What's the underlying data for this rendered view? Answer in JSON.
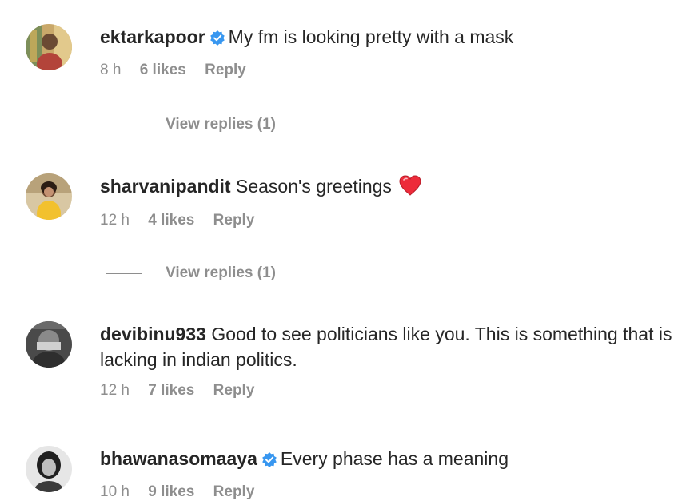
{
  "colors": {
    "text": "#262626",
    "muted": "#8e8e8e",
    "verified": "#3897f0",
    "heart": "#ed2b3a"
  },
  "comments": [
    {
      "username": "ektarkapoor",
      "verified": true,
      "text": "My fm is looking pretty with a mask",
      "time": "8 h",
      "likes": "6 likes",
      "reply": "Reply",
      "view_replies": "View replies (1)",
      "avatar": "avatar"
    },
    {
      "username": "sharvanipandit",
      "verified": false,
      "text": "Season's greetings",
      "emoji": "heart-icon",
      "time": "12 h",
      "likes": "4 likes",
      "reply": "Reply",
      "view_replies": "View replies (1)",
      "avatar": "avatar"
    },
    {
      "username": "devibinu933",
      "verified": false,
      "text": "Good to see politicians like you. This is something that is lacking in indian politics.",
      "time": "12 h",
      "likes": "7 likes",
      "reply": "Reply",
      "avatar": "avatar"
    },
    {
      "username": "bhawanasomaaya",
      "verified": true,
      "text": "Every phase has a meaning",
      "time": "10 h",
      "likes": "9 likes",
      "reply": "Reply",
      "avatar": "avatar"
    }
  ]
}
